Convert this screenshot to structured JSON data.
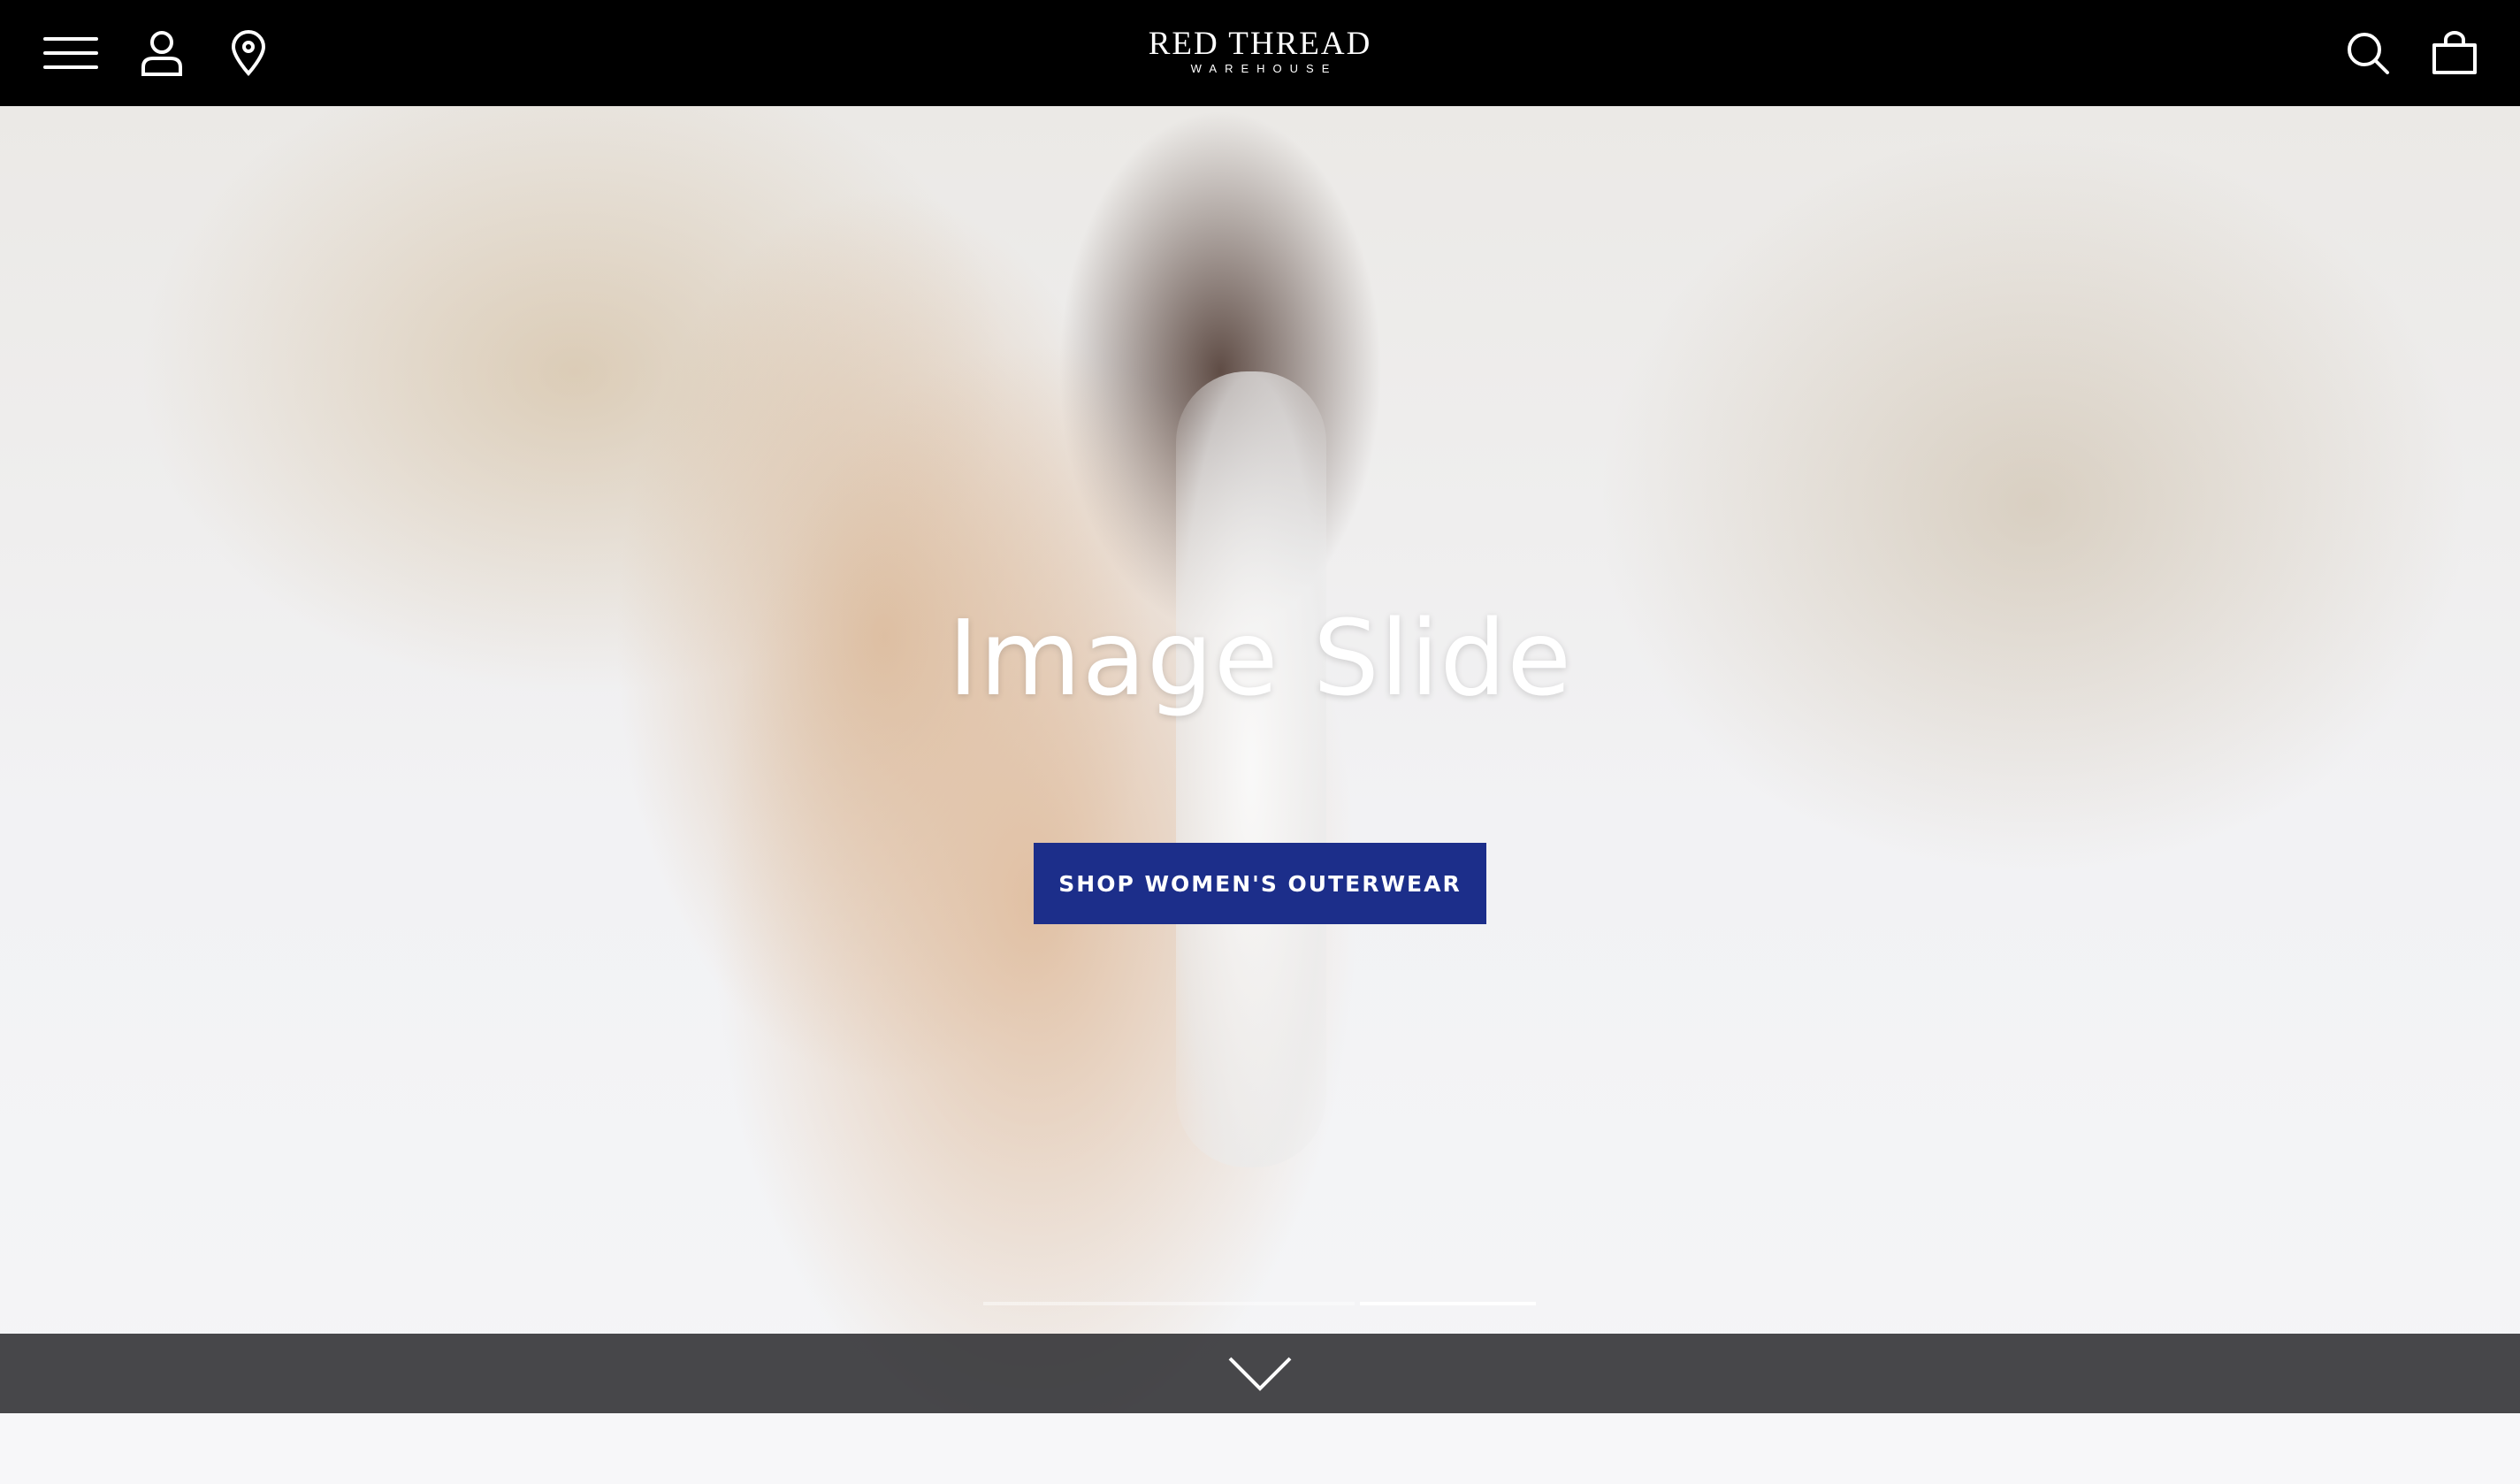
{
  "header": {
    "logo_main": "RED THREAD",
    "logo_sub": "WAREHOUSE",
    "icons": [
      "menu-icon",
      "account-icon",
      "location-pin-icon",
      "search-icon",
      "shopping-bag-icon"
    ]
  },
  "hero": {
    "title": "Image Slide",
    "cta_label": "SHOP WOMEN'S OUTERWEAR",
    "slide_count": 2,
    "active_slide": 2
  },
  "colors": {
    "header_bg": "#000000",
    "cta_bg": "#1c2e8a",
    "scroll_bar_bg": "#28282c"
  }
}
